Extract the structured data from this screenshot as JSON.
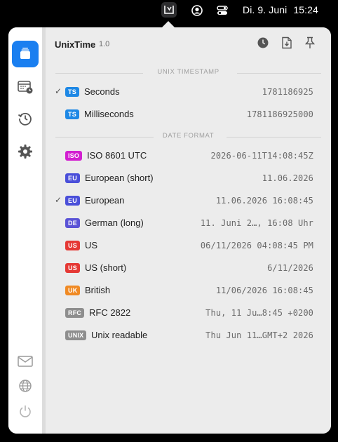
{
  "menubar": {
    "app_icon": "unixtime-app-icon",
    "icons": [
      "account-circle-icon",
      "control-center-icon"
    ],
    "date": "Di. 9. Juni",
    "time": "15:24"
  },
  "app": {
    "name": "UnixTime",
    "version": "1.0"
  },
  "colors": {
    "accent": "#1a7ff0",
    "badge_ts": "#1e88e5",
    "badge_iso": "#d21fd0",
    "badge_eu": "#4a4fd9",
    "badge_de": "#5a53d6",
    "badge_us": "#e53935",
    "badge_uk": "#f08a24",
    "badge_rfc": "#8e8e8e",
    "badge_unix": "#8e8e8e"
  },
  "sidebar": {
    "items": [
      {
        "icon": "stack-icon",
        "active": true
      },
      {
        "icon": "calendar-clock-icon",
        "active": false
      },
      {
        "icon": "history-icon",
        "active": false
      },
      {
        "icon": "gear-icon",
        "active": false
      }
    ],
    "bottom_items": [
      {
        "icon": "envelope-icon"
      },
      {
        "icon": "globe-icon"
      },
      {
        "icon": "power-icon"
      }
    ]
  },
  "header_actions": [
    {
      "icon": "clock-icon"
    },
    {
      "icon": "export-file-icon"
    },
    {
      "icon": "pin-icon"
    }
  ],
  "sections": {
    "unix": {
      "title": "UNIX TIMESTAMP",
      "rows": [
        {
          "checked": true,
          "badge": "TS",
          "label": "Seconds",
          "value": "1781186925"
        },
        {
          "checked": false,
          "badge": "TS",
          "label": "Milliseconds",
          "value": "1781186925000"
        }
      ]
    },
    "date": {
      "title": "DATE FORMAT",
      "rows": [
        {
          "checked": false,
          "badge": "ISO",
          "label": "ISO 8601 UTC",
          "value": "2026-06-11T14:08:45Z"
        },
        {
          "checked": false,
          "badge": "EU",
          "label": "European (short)",
          "value": "11.06.2026"
        },
        {
          "checked": true,
          "badge": "EU",
          "label": "European",
          "value": "11.06.2026 16:08:45"
        },
        {
          "checked": false,
          "badge": "DE",
          "label": "German (long)",
          "value": "11. Juni 2…, 16:08 Uhr"
        },
        {
          "checked": false,
          "badge": "US",
          "label": "US",
          "value": "06/11/2026 04:08:45 PM"
        },
        {
          "checked": false,
          "badge": "US",
          "label": "US (short)",
          "value": "6/11/2026"
        },
        {
          "checked": false,
          "badge": "UK",
          "label": "British",
          "value": "11/06/2026 16:08:45"
        },
        {
          "checked": false,
          "badge": "RFC",
          "label": "RFC 2822",
          "value": "Thu, 11 Ju…8:45 +0200"
        },
        {
          "checked": false,
          "badge": "UNIX",
          "label": "Unix readable",
          "value": "Thu Jun 11…GMT+2 2026"
        }
      ]
    }
  },
  "check_glyph": "✓"
}
